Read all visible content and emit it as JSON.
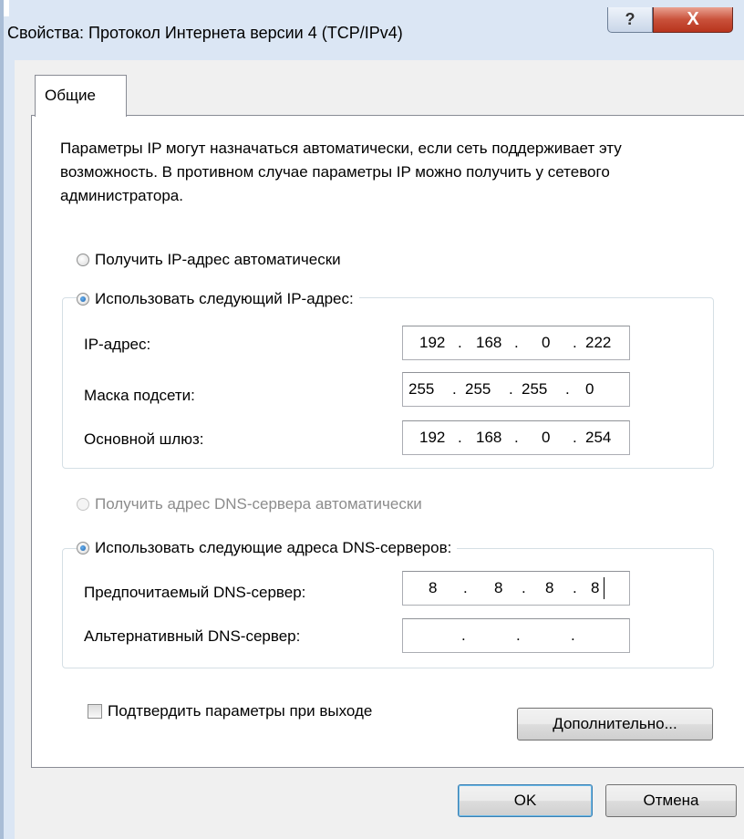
{
  "window": {
    "title": "Свойства: Протокол Интернета версии 4 (TCP/IPv4)"
  },
  "titlebar": {
    "help_glyph": "?",
    "close_glyph": "X"
  },
  "tabs": [
    {
      "label": "Общие",
      "selected": true
    }
  ],
  "description": "Параметры IP могут назначаться автоматически, если сеть поддерживает эту возможность. В противном случае параметры IP можно получить у сетевого администратора.",
  "ip": {
    "auto_label": "Получить IP-адрес автоматически",
    "manual_label": "Использовать следующий IP-адрес:",
    "selected": "manual",
    "fields": [
      {
        "label": "IP-адрес:",
        "octets": [
          "192",
          "168",
          "0",
          "222"
        ]
      },
      {
        "label": "Маска подсети:",
        "octets": [
          "255",
          "255",
          "255",
          "0"
        ]
      },
      {
        "label": "Основной шлюз:",
        "octets": [
          "192",
          "168",
          "0",
          "254"
        ]
      }
    ]
  },
  "dns": {
    "auto_label": "Получить адрес DNS-сервера автоматически",
    "manual_label": "Использовать следующие адреса DNS-серверов:",
    "selected": "manual",
    "fields": [
      {
        "label": "Предпочитаемый DNS-сервер:",
        "octets": [
          "8",
          "8",
          "8",
          "8"
        ]
      },
      {
        "label": "Альтернативный DNS-сервер:",
        "octets": [
          "",
          "",
          "",
          ""
        ]
      }
    ]
  },
  "ip_dot": ".",
  "validate_label": "Подтвердить параметры при выходе",
  "validate_checked": false,
  "buttons": {
    "advanced": "Дополнительно...",
    "ok": "OK",
    "cancel": "Отмена"
  }
}
